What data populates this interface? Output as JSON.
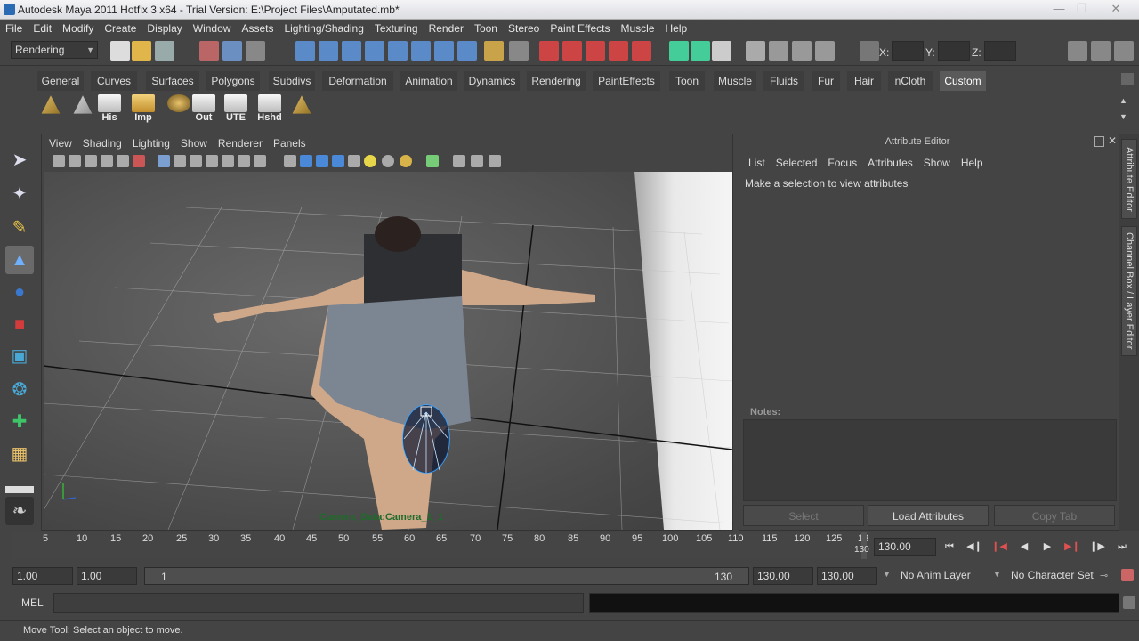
{
  "titlebar": {
    "title": "Autodesk Maya 2011 Hotfix 3 x64 - Trial Version: E:\\Project Files\\Amputated.mb*"
  },
  "menubar": {
    "items": [
      "File",
      "Edit",
      "Modify",
      "Create",
      "Display",
      "Window",
      "Assets",
      "Lighting/Shading",
      "Texturing",
      "Render",
      "Toon",
      "Stereo",
      "Paint Effects",
      "Muscle",
      "Help"
    ]
  },
  "statusline": {
    "menuset": "Rendering",
    "x_label": "X:",
    "y_label": "Y:",
    "z_label": "Z:"
  },
  "shelf": {
    "tabs": [
      "General",
      "Curves",
      "Surfaces",
      "Polygons",
      "Subdivs",
      "Deformation",
      "Animation",
      "Dynamics",
      "Rendering",
      "PaintEffects",
      "Toon",
      "Muscle",
      "Fluids",
      "Fur",
      "Hair",
      "nCloth",
      "Custom"
    ],
    "active_tab": "Custom",
    "buttons": [
      {
        "label": "",
        "icon": "poly-grid-icon"
      },
      {
        "label": "",
        "icon": "plane-icon"
      },
      {
        "label": "His",
        "icon": "history-icon"
      },
      {
        "label": "Imp",
        "icon": "import-icon"
      },
      {
        "label": "",
        "icon": "globe-icon"
      },
      {
        "label": "Out",
        "icon": "outliner-icon"
      },
      {
        "label": "UTE",
        "icon": "uv-editor-icon"
      },
      {
        "label": "Hshd",
        "icon": "hypershade-icon"
      },
      {
        "label": "",
        "icon": "poly-grid-icon"
      }
    ]
  },
  "viewport": {
    "menu": [
      "View",
      "Shading",
      "Lighting",
      "Show",
      "Renderer",
      "Panels"
    ],
    "camera_label": "Camera_Data:Camera_1_1"
  },
  "attribute_editor": {
    "title": "Attribute Editor",
    "menu": [
      "List",
      "Selected",
      "Focus",
      "Attributes",
      "Show",
      "Help"
    ],
    "message": "Make a selection to view attributes",
    "notes_label": "Notes:",
    "select_button": "Select",
    "load_button": "Load Attributes",
    "copy_button": "Copy Tab"
  },
  "side_tabs": {
    "attribute_editor": "Attribute Editor",
    "channel_box": "Channel Box / Layer Editor"
  },
  "timeline": {
    "ticks": [
      "5",
      "10",
      "15",
      "20",
      "25",
      "30",
      "35",
      "40",
      "45",
      "50",
      "55",
      "60",
      "65",
      "70",
      "75",
      "80",
      "85",
      "90",
      "95",
      "100",
      "105",
      "110",
      "115",
      "120",
      "125",
      "13"
    ],
    "current_frame_marker": "130",
    "current_frame": "130.00"
  },
  "range": {
    "start_time": "1.00",
    "playback_start": "1.00",
    "slider_start": "1",
    "slider_end": "130",
    "playback_end": "130.00",
    "end_time": "130.00",
    "anim_layer": "No Anim Layer",
    "character_set": "No Character Set"
  },
  "command": {
    "mel_label": "MEL"
  },
  "help": {
    "text": "Move Tool: Select an object to move."
  }
}
